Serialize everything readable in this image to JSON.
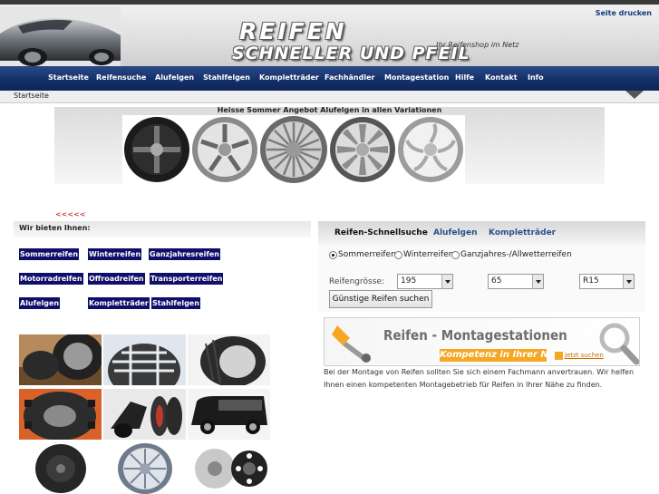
{
  "header": {
    "print_link": "Seite drucken",
    "logo_line1": "REIFEN",
    "logo_line2": "SCHNELLER UND PFEIL",
    "tagline": "....Ihr Reifenshop im Netz"
  },
  "nav": {
    "items": [
      "Startseite",
      "Reifensuche",
      "Alufelgen",
      "Stahlfelgen",
      "Kompletträder",
      "Fachhändler",
      "Montagestation",
      "Hilfe",
      "Kontakt",
      "Info"
    ]
  },
  "breadcrumb": "Startseite",
  "banner": {
    "title": "Heisse Sommer Angebot Alufelgen in allen Variationen",
    "back_link": "<<<<<"
  },
  "offers": {
    "title": "Wir bieten Ihnen:",
    "categories": [
      "Sommerreifen",
      "Winterreifen",
      "Ganzjahresreifen",
      "Motorradreifen",
      "Offroadreifen",
      "Transporterreifen",
      "Alufelgen",
      "Kompletträder",
      "Stahlfelgen"
    ]
  },
  "quicksearch": {
    "tabs": [
      "Reifen-Schnellsuche",
      "Alufelgen",
      "Kompletträder"
    ],
    "season_options": [
      "Sommerreifen",
      "Winterreifen",
      "Ganzjahres-/Allwetterreifen"
    ],
    "selected_season": "Sommerreifen",
    "size_label": "Reifengrösse:",
    "width": "195",
    "ratio": "65",
    "rim": "R15",
    "submit_label": "Günstige Reifen suchen"
  },
  "montage": {
    "title": "Reifen - Montagestationen",
    "subtitle": "Kompetenz in Ihrer Nähe.",
    "cta": "Jetzt suchen",
    "description": "Bei der Montage von Reifen sollten Sie sich einem Fachmann anvertrauen. Wir helfen Ihnen einen kompetenten Montagebetrieb für Reifen in Ihrer Nähe zu finden."
  }
}
